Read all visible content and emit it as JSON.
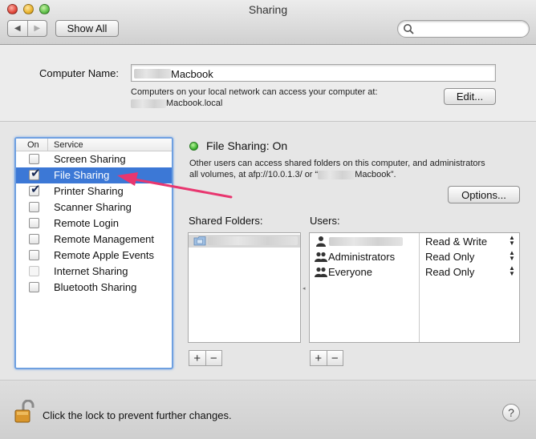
{
  "window": {
    "title": "Sharing"
  },
  "toolbar": {
    "back_glyph": "◀",
    "forward_glyph": "▶",
    "show_all_label": "Show All",
    "search_value": "",
    "search_placeholder": ""
  },
  "computer_name": {
    "label": "Computer Name:",
    "value_suffix": "Macbook",
    "note_line1": "Computers on your local network can access your computer at:",
    "note_line2_suffix": "Macbook.local",
    "edit_label": "Edit..."
  },
  "services": {
    "col_on": "On",
    "col_service": "Service",
    "items": [
      {
        "label": "Screen Sharing",
        "checked": false
      },
      {
        "label": "File Sharing",
        "checked": true,
        "selected": true
      },
      {
        "label": "Printer Sharing",
        "checked": true
      },
      {
        "label": "Scanner Sharing",
        "checked": false
      },
      {
        "label": "Remote Login",
        "checked": false
      },
      {
        "label": "Remote Management",
        "checked": false
      },
      {
        "label": "Remote Apple Events",
        "checked": false
      },
      {
        "label": "Internet Sharing",
        "checked": false,
        "disabled": true
      },
      {
        "label": "Bluetooth Sharing",
        "checked": false
      }
    ]
  },
  "status": {
    "title": "File Sharing: On",
    "desc_line1": "Other users can access shared folders on this computer, and administrators",
    "desc_line2_prefix": "all volumes, at afp://10.0.1.3/ or “",
    "desc_line2_suffix": "Macbook”.",
    "options_label": "Options...",
    "indicator_color": "#38b02c"
  },
  "shared_folders": {
    "label": "Shared Folders:"
  },
  "users": {
    "label": "Users:",
    "rows": [
      {
        "name": "",
        "permission": "Read & Write",
        "icon": "single-user-icon"
      },
      {
        "name": "Administrators",
        "permission": "Read Only",
        "icon": "group-icon"
      },
      {
        "name": "Everyone",
        "permission": "Read Only",
        "icon": "group-icon"
      }
    ]
  },
  "list_controls": {
    "add": "+",
    "remove": "−"
  },
  "footer": {
    "lock_text": "Click the lock to prevent further changes.",
    "help_label": "?"
  },
  "colors": {
    "selection": "#3c78d6",
    "focus_ring": "#6fa0e0",
    "annotation_arrow": "#e8366f"
  }
}
